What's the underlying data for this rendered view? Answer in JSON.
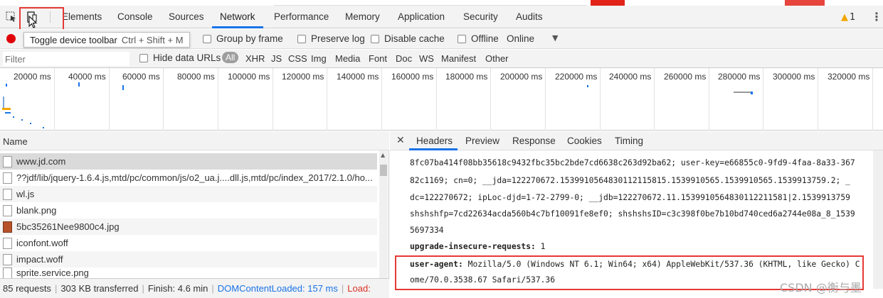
{
  "tabs": [
    "Elements",
    "Console",
    "Sources",
    "Network",
    "Performance",
    "Memory",
    "Application",
    "Security",
    "Audits"
  ],
  "active_tab": "Network",
  "warnings_count": "1",
  "tooltip": {
    "text": "Toggle device toolbar",
    "shortcut": "Ctrl + Shift + M"
  },
  "toolbar": {
    "group_by_frame": "Group by frame",
    "preserve_log": "Preserve log",
    "disable_cache": "Disable cache",
    "offline": "Offline",
    "throttle": "Online"
  },
  "filter": {
    "placeholder": "Filter",
    "hide_data_urls": "Hide data URLs",
    "types": [
      "All",
      "XHR",
      "JS",
      "CSS",
      "Img",
      "Media",
      "Font",
      "Doc",
      "WS",
      "Manifest",
      "Other"
    ]
  },
  "overview_ticks": [
    "20000 ms",
    "40000 ms",
    "60000 ms",
    "80000 ms",
    "100000 ms",
    "120000 ms",
    "140000 ms",
    "160000 ms",
    "180000 ms",
    "200000 ms",
    "220000 ms",
    "240000 ms",
    "260000 ms",
    "280000 ms",
    "300000 ms",
    "320000 ms"
  ],
  "requests_header": "Name",
  "requests": [
    "www.jd.com",
    "??jdf/lib/jquery-1.6.4.js,mtd/pc/common/js/o2_ua.j....dll.js,mtd/pc/index_2017/2.1.0/ho...",
    "wl.js",
    "blank.png",
    "5bc35261Nee9800c4.jpg",
    "iconfont.woff",
    "impact.woff",
    "sprite.service.png"
  ],
  "status": {
    "requests": "85 requests",
    "transferred": "303 KB transferred",
    "finish": "Finish: 4.6 min",
    "dcl": "DOMContentLoaded: 157 ms",
    "load": "Load:"
  },
  "detail_tabs": [
    "Headers",
    "Preview",
    "Response",
    "Cookies",
    "Timing"
  ],
  "headers_lines": {
    "l1": "8fc07ba414f08bb35618c9432fbc35bc2bde7cd6638c263d92ba62; user-key=e66855c0-9fd9-4faa-8a33-367",
    "l2": "82c1169; cn=0; __jda=122270672.1539910564830112115815.1539910565.1539910565.1539913759.2; _",
    "l3": "dc=122270672; ipLoc-djd=1-72-2799-0; __jdb=122270672.11.1539910564830112211581|2.1539913759",
    "l4": "shshshfp=7cd22634acda560b4c7bf10091fe8ef0; shshshsID=c3c398f0be7b10bd740ced6a2744e08a_8_1539",
    "l5": "5697334",
    "uir_key": "upgrade-insecure-requests:",
    "uir_val": "1",
    "ua_key": "user-agent:",
    "ua_val": "Mozilla/5.0 (Windows NT 6.1; Win64; x64) AppleWebKit/537.36 (KHTML, like Gecko) C",
    "ua_cont": "ome/70.0.3538.67 Safari/537.36"
  },
  "watermark": "CSDN @衡与墨",
  "colors": {
    "accent": "#1a73e8",
    "record": "#e0000a",
    "highlight": "#e53935"
  }
}
